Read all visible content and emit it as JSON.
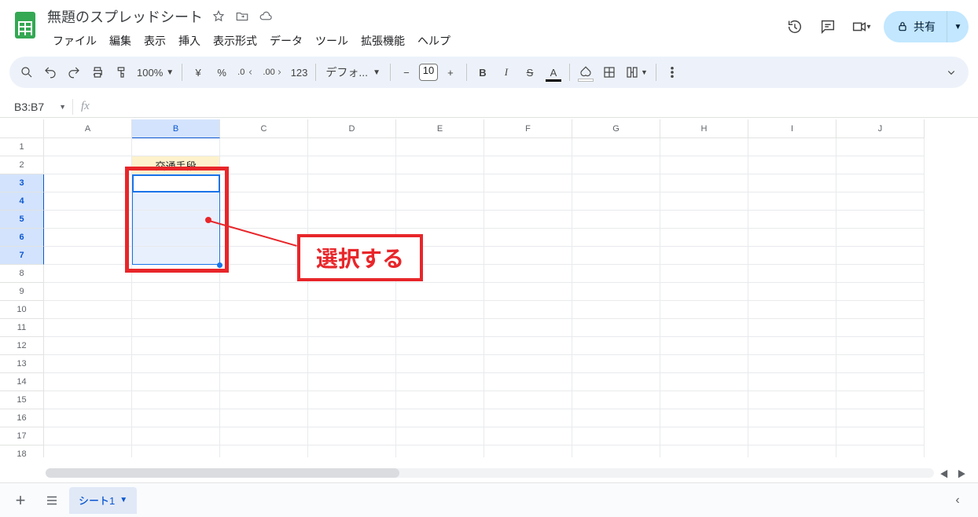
{
  "doc": {
    "title": "無題のスプレッドシート"
  },
  "menus": [
    "ファイル",
    "編集",
    "表示",
    "挿入",
    "表示形式",
    "データ",
    "ツール",
    "拡張機能",
    "ヘルプ"
  ],
  "share": {
    "label": "共有"
  },
  "toolbar": {
    "zoom": "100%",
    "currency": "¥",
    "percent": "%",
    "dec_dec": ".0",
    "dec_inc": ".00",
    "fmt123": "123",
    "font": "デフォ...",
    "fontsize": "10"
  },
  "namebox": "B3:B7",
  "columns": [
    "A",
    "B",
    "C",
    "D",
    "E",
    "F",
    "G",
    "H",
    "I",
    "J"
  ],
  "rows_visible": 18,
  "selected_col_index": 1,
  "selected_row_start": 3,
  "selected_row_end": 7,
  "b2_value": "交通手段",
  "annotation": {
    "label": "選択する"
  },
  "sheet": {
    "tab1": "シート1"
  }
}
